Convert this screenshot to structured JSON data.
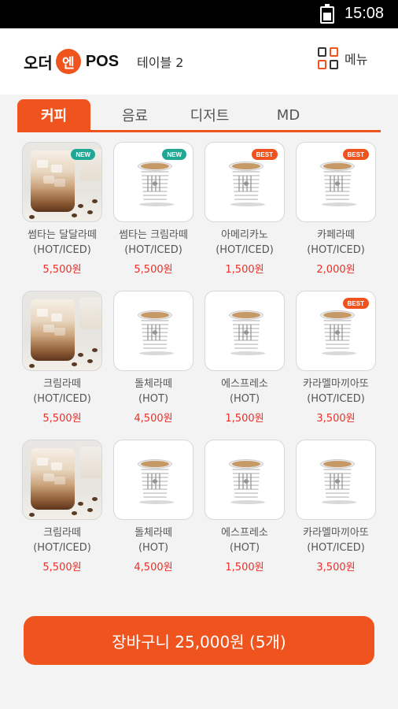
{
  "statusbar": {
    "time": "15:08",
    "battery_icon": "battery-icon"
  },
  "header": {
    "logo_left": "오더",
    "logo_accent": "엔",
    "logo_right": "POS",
    "table": "테이블 2",
    "menu_label": "메뉴",
    "menu_icon": "grid-menu-icon",
    "accent_color": "#f0541e"
  },
  "tabs": [
    {
      "label": "커피",
      "active": true
    },
    {
      "label": "음료",
      "active": false
    },
    {
      "label": "디저트",
      "active": false
    },
    {
      "label": "MD",
      "active": false
    }
  ],
  "products": [
    {
      "name": "썸타는 달달라떼",
      "temp": "(HOT/ICED)",
      "price": "5,500원",
      "badge": "NEW",
      "image": "iced-latte-photo"
    },
    {
      "name": "썸타는 크림라떼",
      "temp": "(HOT/ICED)",
      "price": "5,500원",
      "badge": "NEW",
      "image": "paper-cup"
    },
    {
      "name": "아메리카노",
      "temp": "(HOT/ICED)",
      "price": "1,500원",
      "badge": "BEST",
      "image": "paper-cup"
    },
    {
      "name": "카페라떼",
      "temp": "(HOT/ICED)",
      "price": "2,000원",
      "badge": "BEST",
      "image": "paper-cup"
    },
    {
      "name": "크림라떼",
      "temp": "(HOT/ICED)",
      "price": "5,500원",
      "badge": "",
      "image": "iced-latte-photo"
    },
    {
      "name": "돌체라떼",
      "temp": "(HOT)",
      "price": "4,500원",
      "badge": "",
      "image": "paper-cup"
    },
    {
      "name": "에스프레소",
      "temp": "(HOT)",
      "price": "1,500원",
      "badge": "",
      "image": "paper-cup"
    },
    {
      "name": "카라멜마끼아또",
      "temp": "(HOT/ICED)",
      "price": "3,500원",
      "badge": "BEST",
      "image": "paper-cup"
    },
    {
      "name": "크림라떼",
      "temp": "(HOT/ICED)",
      "price": "5,500원",
      "badge": "",
      "image": "iced-latte-photo"
    },
    {
      "name": "돌체라떼",
      "temp": "(HOT)",
      "price": "4,500원",
      "badge": "",
      "image": "paper-cup"
    },
    {
      "name": "에스프레소",
      "temp": "(HOT)",
      "price": "1,500원",
      "badge": "",
      "image": "paper-cup"
    },
    {
      "name": "카라멜마끼아또",
      "temp": "(HOT/ICED)",
      "price": "3,500원",
      "badge": "",
      "image": "paper-cup"
    }
  ],
  "cart": {
    "label": "장바구니 25,000원 (5개)"
  }
}
